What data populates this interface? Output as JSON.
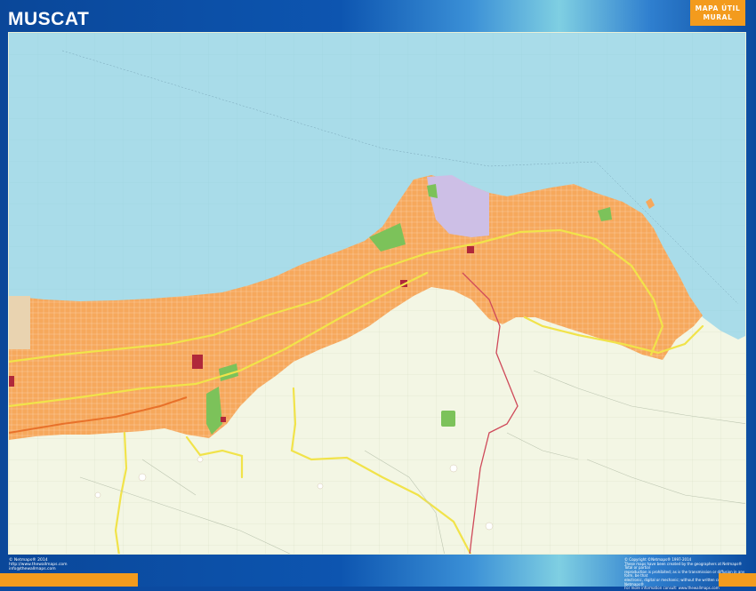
{
  "header": {
    "title": "MUSCAT",
    "badge_line1": "MAPA ÚTIL",
    "badge_line2": "MURAL"
  },
  "footer": {
    "left_lines": [
      "© Netmaps® 2014",
      "http://www.thewallmaps.com",
      "info@thewallmaps.com"
    ],
    "right_lines": [
      "© Copyright ©Netmaps® 1997-2014",
      "These maps have been created by the geographers at Netmaps® Total or partial",
      "reproduction is prohibited; as is the transmission or diffusion in any form, be that",
      "electronic, digital or mechanic; without the written consent of Netmaps®",
      "For more information consult: www.thewallmaps.com"
    ]
  },
  "colors": {
    "sea": "#a9dce9",
    "urban": "#f6a85c",
    "land": "#f3f6e4",
    "park": "#7cc25a",
    "port": "#cdbfe6",
    "highway": "#f1e34a",
    "main_road": "#cf4a5a",
    "brand_orange": "#f39b1d",
    "frame_blue": "#0a4799"
  }
}
